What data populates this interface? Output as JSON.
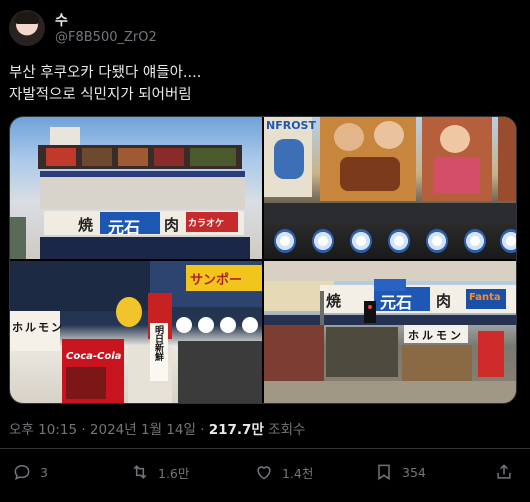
{
  "author": {
    "name": "수",
    "handle": "@F8B500_ZrO2"
  },
  "tweet": {
    "line1": "부산 후쿠오카 다됐다 얘들아....",
    "line2": "자발적으로 식민지가 되어버림"
  },
  "photos": {
    "p1": {
      "sign_main": "元石",
      "sign_left": "焼",
      "sign_right": "肉",
      "banner": "カラオケ"
    },
    "p2": {
      "sign": "NFROST"
    },
    "p3": {
      "sign": "サンポー",
      "cola": "Coca-Cola",
      "vertical": "明日新鮮",
      "lanterns": "ホルモン"
    },
    "p4": {
      "sign_main": "元石",
      "sign_left": "焼",
      "sign_right": "肉",
      "brand": "Fanta",
      "street_sign": "ホルモン"
    }
  },
  "meta": {
    "time": "오후 10:15 · 2024년 1월 14일 · ",
    "views": "217.7만",
    "views_label": " 조회수"
  },
  "actions": {
    "replies": "3",
    "retweets": "1.6만",
    "likes": "1.4천",
    "bookmarks": "354"
  }
}
